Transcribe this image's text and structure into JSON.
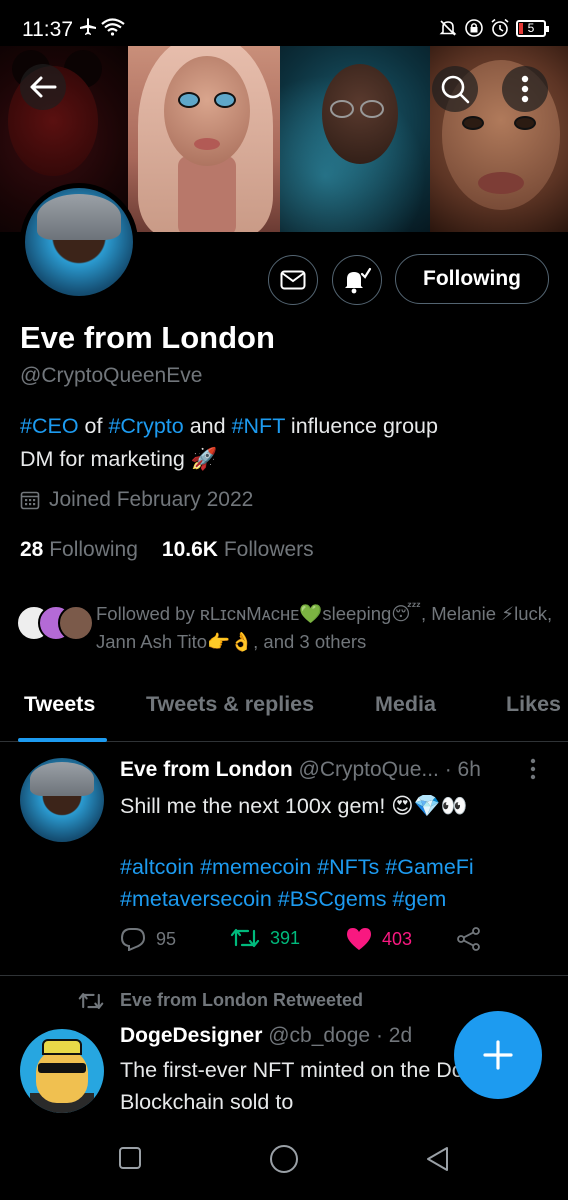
{
  "status_bar": {
    "time": "11:37",
    "battery": "5"
  },
  "profile": {
    "display_name": "Eve from London",
    "handle": "@CryptoQueenEve",
    "bio_line1": [
      {
        "text": "#CEO",
        "tag": true
      },
      {
        "text": " of ",
        "tag": false
      },
      {
        "text": "#Crypto",
        "tag": true
      },
      {
        "text": " and ",
        "tag": false
      },
      {
        "text": "#NFT",
        "tag": true
      },
      {
        "text": " influence group",
        "tag": false
      }
    ],
    "bio_line2": "DM for marketing 🚀",
    "joined": "Joined February 2022",
    "following_count": "28",
    "following_label": "Following",
    "followers_count": "10.6K",
    "followers_label": "Followers",
    "followed_by": "Followed by ʀLɪᴄɴMᴀᴄʜᴇ💚sleeping😴, Melanie ⚡luck, Jann Ash Tito👉👌, and 3 others",
    "follow_button": "Following"
  },
  "tabs": [
    "Tweets",
    "Tweets & replies",
    "Media",
    "Likes"
  ],
  "tweet": {
    "author": "Eve from London",
    "handle_time": "@CryptoQue... · 6h",
    "text": "Shill me the next 100x gem! 😍💎👀",
    "hashtags": "#altcoin #memecoin #NFTs #GameFi #metaversecoin #BSCgems #gem",
    "replies": "95",
    "retweets": "391",
    "likes": "403"
  },
  "retweet": {
    "label": "Eve from London Retweeted",
    "author": "DogeDesigner",
    "handle_time": "@cb_doge · 2d",
    "text": "The first-ever NFT minted on the Dogecoin Blockchain sold to"
  },
  "colors": {
    "accent": "#1d9bf0",
    "retweet_green": "#00ba7c",
    "like_pink": "#f91880",
    "muted": "#71767b",
    "border": "#2f3336"
  },
  "icons": {
    "back": "arrow-left-icon",
    "search": "search-icon",
    "more": "more-vertical-icon",
    "message": "envelope-icon",
    "notifications": "bell-check-icon",
    "calendar": "calendar-icon",
    "reply": "reply-icon",
    "retweet": "retweet-icon",
    "like": "heart-icon",
    "share": "share-icon",
    "compose": "plus-icon"
  }
}
